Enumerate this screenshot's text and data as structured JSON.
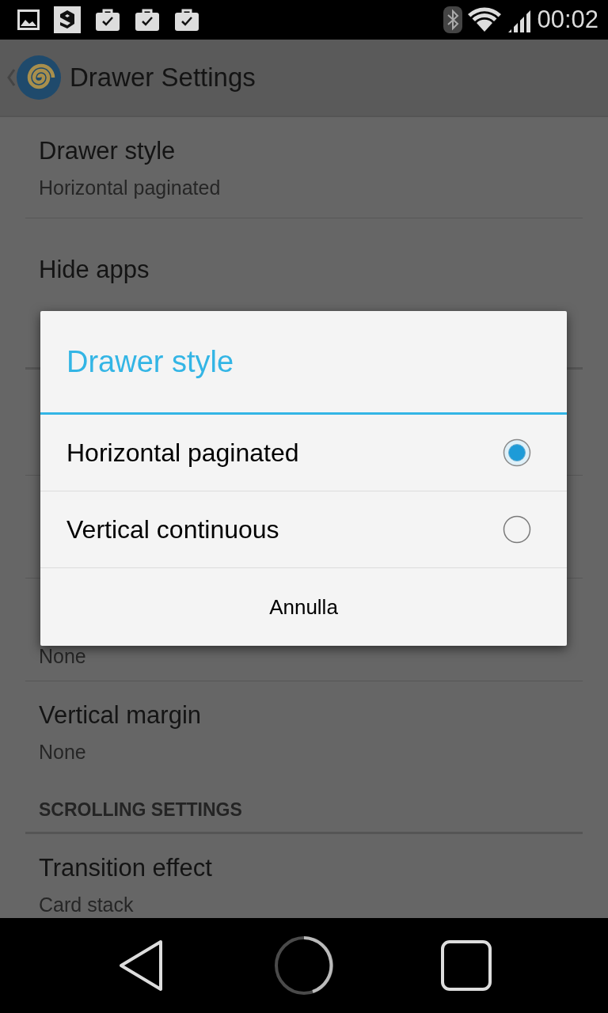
{
  "status_bar": {
    "time": "00:02"
  },
  "action_bar": {
    "title": "Drawer Settings"
  },
  "settings": [
    {
      "kind": "item",
      "title": "Drawer style",
      "summary": "Horizontal paginated"
    },
    {
      "kind": "item",
      "title": "Hide apps"
    },
    {
      "kind": "partial",
      "summary": "None"
    },
    {
      "kind": "item",
      "title": "Vertical margin",
      "summary": "None"
    },
    {
      "kind": "header",
      "title": "SCROLLING SETTINGS"
    },
    {
      "kind": "item",
      "title": "Transition effect",
      "summary": "Card stack"
    }
  ],
  "dialog": {
    "title": "Drawer style",
    "options": [
      {
        "label": "Horizontal paginated",
        "selected": true
      },
      {
        "label": "Vertical continuous",
        "selected": false
      }
    ],
    "cancel_button": "Annulla"
  }
}
